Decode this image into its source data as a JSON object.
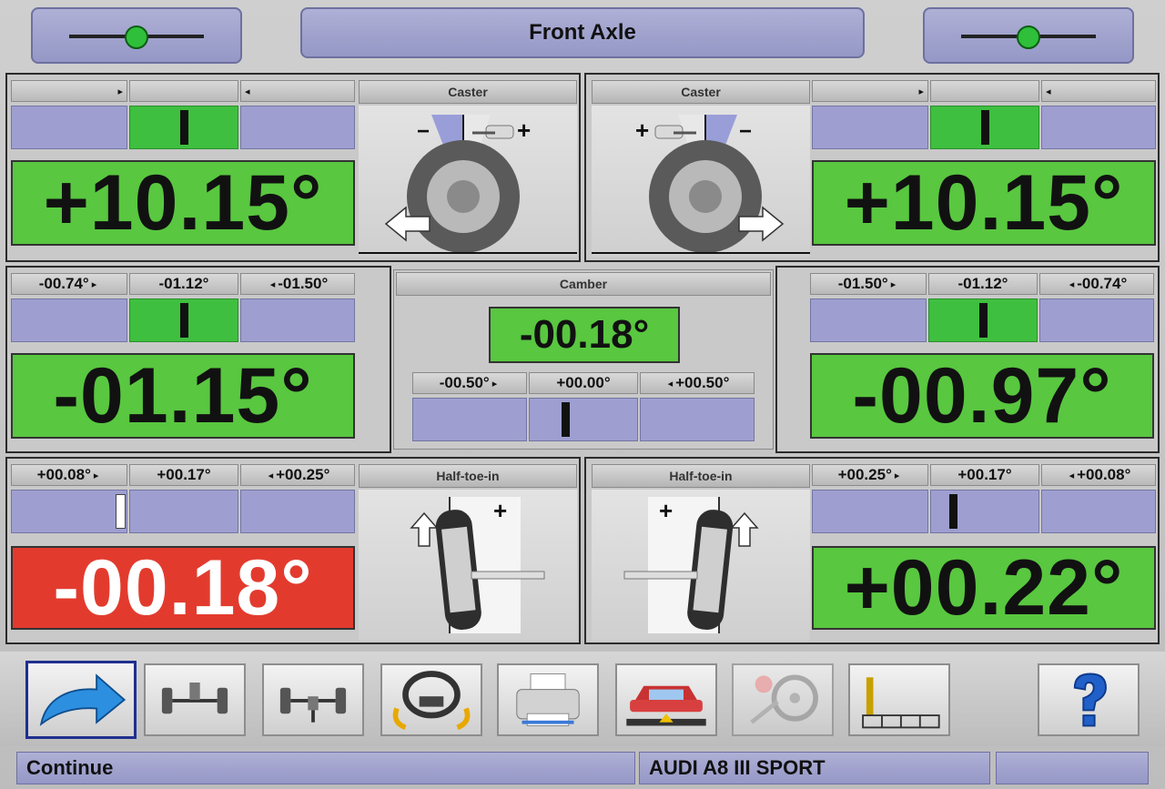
{
  "header": {
    "title": "Front Axle"
  },
  "caster": {
    "left_title": "Caster",
    "right_title": "Caster",
    "left_value": "+10.15°",
    "right_value": "+10.15°",
    "left_needle": 0.5,
    "right_needle": 0.5
  },
  "camber": {
    "title": "Camber",
    "left_ticks": [
      "-00.74°",
      "-01.12°",
      "-01.50°"
    ],
    "right_ticks": [
      "-01.50°",
      "-01.12°",
      "-00.74°"
    ],
    "left_value": "-01.15°",
    "right_value": "-00.97°",
    "cross_value": "-00.18°",
    "cross_ticks": [
      "-00.50°",
      "+00.00°",
      "+00.50°"
    ],
    "left_needle": 0.5,
    "right_needle": 0.5,
    "cross_needle": 0.33
  },
  "toe": {
    "left_title": "Half-toe-in",
    "right_title": "Half-toe-in",
    "left_ticks": [
      "+00.08°",
      "+00.17°",
      "+00.25°"
    ],
    "right_ticks": [
      "+00.25°",
      "+00.17°",
      "+00.08°"
    ],
    "left_value": "-00.18°",
    "right_value": "+00.22°",
    "left_needle": -0.1,
    "right_needle": 0.2
  },
  "toolbar": {
    "buttons": [
      {
        "icon": "continue-arrow-icon"
      },
      {
        "icon": "front-axle-icon"
      },
      {
        "icon": "rear-axle-icon"
      },
      {
        "icon": "steering-wheel-icon"
      },
      {
        "icon": "printer-icon"
      },
      {
        "icon": "car-lift-icon"
      },
      {
        "icon": "wheel-tools-icon"
      },
      {
        "icon": "bar-graph-icon"
      },
      {
        "icon": "help-icon"
      }
    ]
  },
  "status": {
    "action": "Continue",
    "vehicle": "AUDI A8 III SPORT",
    "extra": ""
  },
  "colors": {
    "in_tolerance": "#59c740",
    "out_of_tolerance": "#e23b2e",
    "panel_blue": "#9e9fd0"
  },
  "glyphs": {
    "plus": "+",
    "minus": "−"
  }
}
